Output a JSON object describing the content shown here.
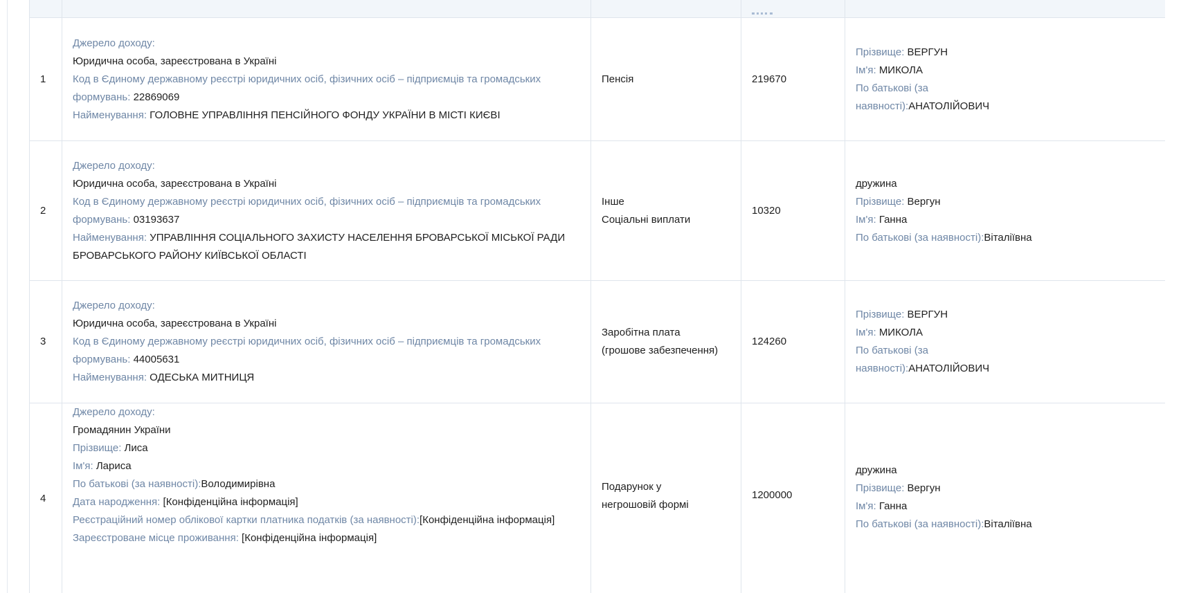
{
  "header": {
    "cols": [
      "",
      "",
      "",
      "",
      ""
    ]
  },
  "labels": {
    "source": "Джерело доходу:",
    "edr_code": "Код в Єдиному державному реєстрі юридичних осіб, фізичних осіб – підприємців та громадських формувань:",
    "name": "Найменування:",
    "surname": "Прізвище:",
    "first_name": "Ім'я:",
    "patronymic": "По батькові (за наявності):",
    "birth_date": "Дата народження:",
    "tax_number": "Реєстраційний номер облікової картки платника податків (за наявності):",
    "residence": "Зареєстроване місце проживання:"
  },
  "rows": [
    {
      "num": "1",
      "source_type": "Юридична особа, зареєстрована в Україні",
      "code": "22869069",
      "name": "ГОЛОВНЕ УПРАВЛІННЯ ПЕНСІЙНОГО ФОНДУ УКРАЇНИ В МІСТІ КИЄВІ",
      "income_type": [
        "Пенсія"
      ],
      "amount": "219670",
      "recipient": {
        "relation": "",
        "surname": "ВЕРГУН",
        "first_name": "МИКОЛА",
        "patronymic_label_1": "По батькові (за",
        "patronymic_label_2": "наявності):",
        "patronymic": "АНАТОЛІЙОВИЧ"
      }
    },
    {
      "num": "2",
      "source_type": "Юридична особа, зареєстрована в Україні",
      "code": "03193637",
      "name_line_1": "УПРАВЛІННЯ СОЦІАЛЬНОГО ЗАХИСТУ НАСЕЛЕННЯ БРОВАРСЬКОЇ МІСЬКОЇ РАДИ",
      "name_line_2": "БРОВАРСЬКОГО РАЙОНУ КИЇВСЬКОЇ ОБЛАСТІ",
      "income_type": [
        "Інше",
        "Соціальні виплати"
      ],
      "amount": "10320",
      "recipient": {
        "relation": "дружина",
        "surname": "Вергун",
        "first_name": "Ганна",
        "patronymic": "Віталіївна"
      }
    },
    {
      "num": "3",
      "source_type": "Юридична особа, зареєстрована в Україні",
      "code": "44005631",
      "name": "ОДЕСЬКА МИТНИЦЯ",
      "income_type": [
        "Заробітна плата",
        "(грошове забезпечення)"
      ],
      "amount": "124260",
      "recipient": {
        "relation": "",
        "surname": "ВЕРГУН",
        "first_name": "МИКОЛА",
        "patronymic_label_1": "По батькові (за",
        "patronymic_label_2": "наявності):",
        "patronymic": "АНАТОЛІЙОВИЧ"
      }
    },
    {
      "num": "4",
      "source_type": "Громадянин України",
      "surname": "Лиса",
      "first_name": "Лариса",
      "patronymic": "Володимирівна",
      "birth_date": "[Конфіденційна інформація]",
      "tax_number": "[Конфіденційна інформація]",
      "residence": "[Конфіденційна інформація]",
      "income_type": [
        "Подарунок у",
        "негрошовій формі"
      ],
      "amount": "1200000",
      "recipient": {
        "relation": "дружина",
        "surname": "Вергун",
        "first_name": "Ганна",
        "patronymic": "Віталіївна"
      }
    }
  ],
  "edr_label_line_1": "Код в Єдиному державному реєстрі юридичних осіб, фізичних осіб – підприємців та громадських",
  "edr_label_line_2": "формувань:"
}
